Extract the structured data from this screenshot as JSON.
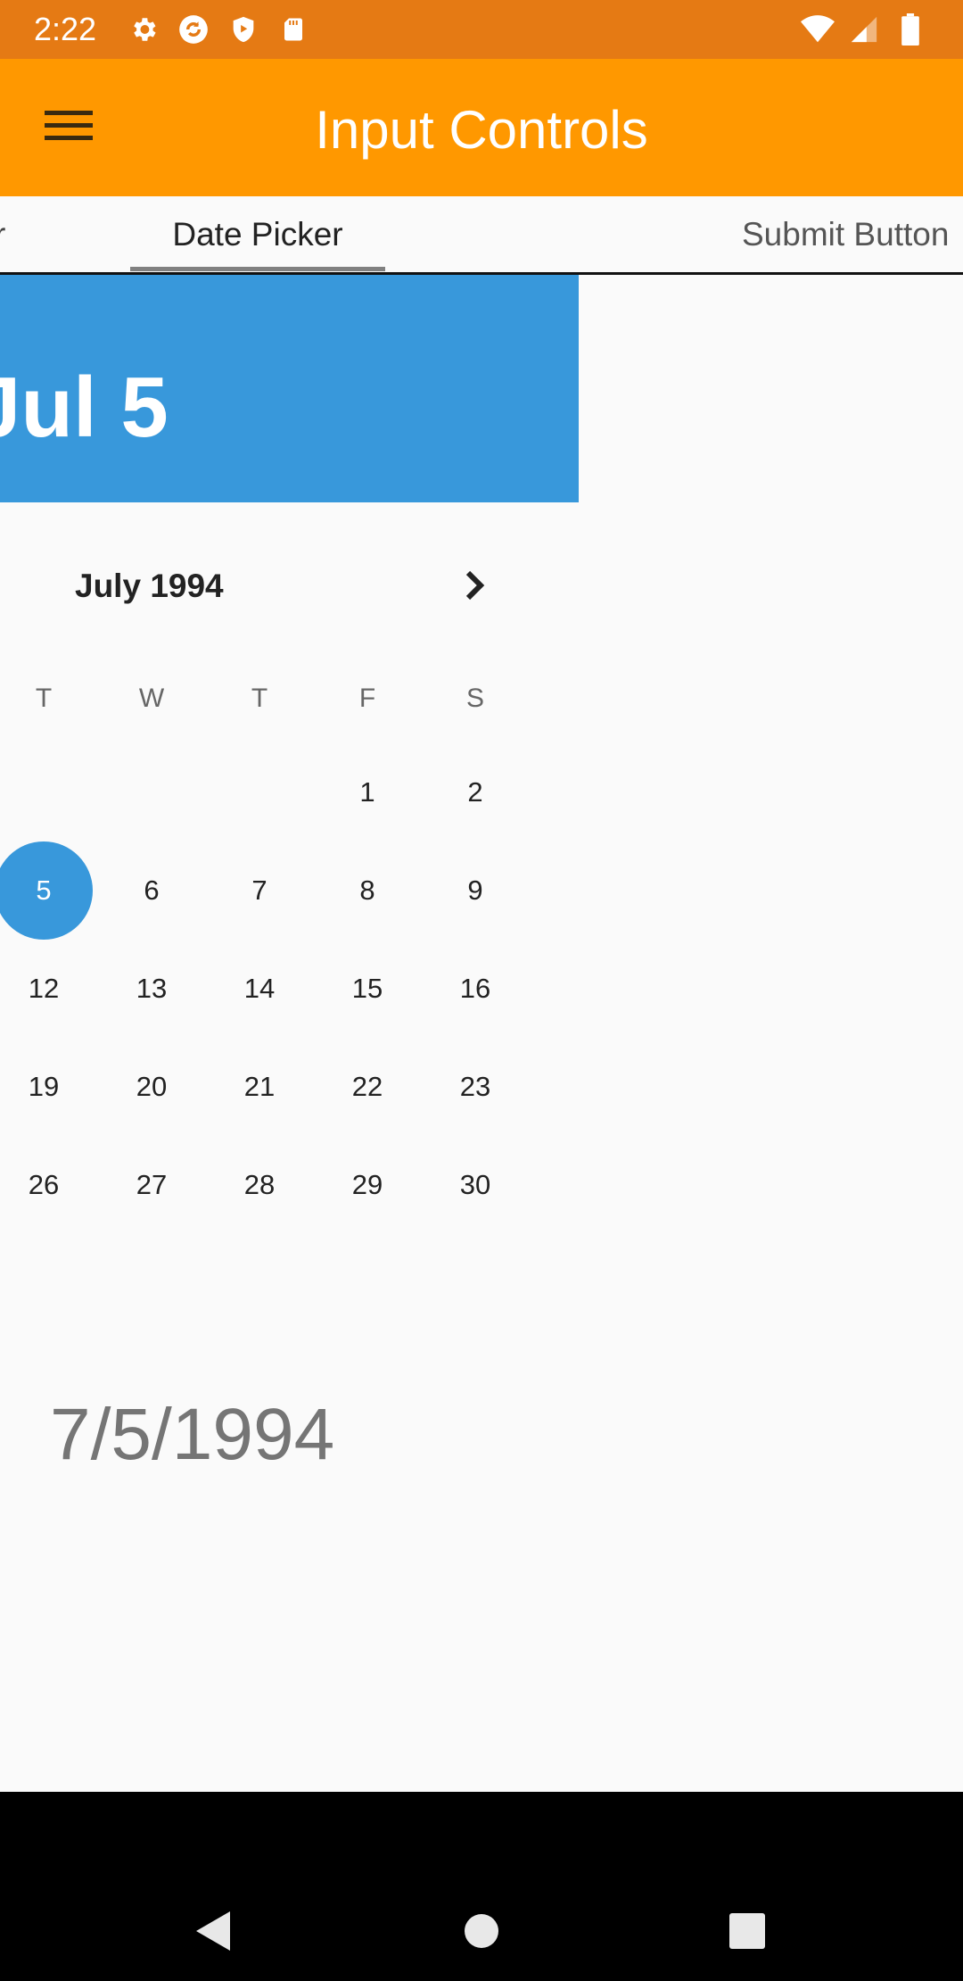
{
  "status_bar": {
    "time": "2:22",
    "left_icons": [
      "settings-icon",
      "sync-icon",
      "shield-play-icon",
      "sd-card-icon"
    ],
    "right_icons": [
      "wifi-icon",
      "signal-icon",
      "battery-icon"
    ],
    "background": "#e57a14"
  },
  "app_bar": {
    "title": "Input Controls",
    "menu_icon": "menu-icon",
    "background": "#ff9800"
  },
  "tabs": {
    "items": [
      {
        "label": "r"
      },
      {
        "label": "Date Picker",
        "selected": true
      },
      {
        "label": "Submit Button"
      }
    ]
  },
  "date_picker": {
    "header_date": "Jul 5",
    "header_color": "#3898db",
    "month_label": "July 1994",
    "next_icon": "chevron-right-icon",
    "weekdays": [
      "T",
      "W",
      "T",
      "F",
      "S"
    ],
    "weeks": [
      [
        "",
        "",
        "",
        "1",
        "2"
      ],
      [
        "5",
        "6",
        "7",
        "8",
        "9"
      ],
      [
        "12",
        "13",
        "14",
        "15",
        "16"
      ],
      [
        "19",
        "20",
        "21",
        "22",
        "23"
      ],
      [
        "26",
        "27",
        "28",
        "29",
        "30"
      ]
    ],
    "selected_day": "5"
  },
  "result": {
    "value": "7/5/1994"
  },
  "nav_bar": {
    "icons": [
      "back-icon",
      "home-icon",
      "recents-icon"
    ]
  }
}
